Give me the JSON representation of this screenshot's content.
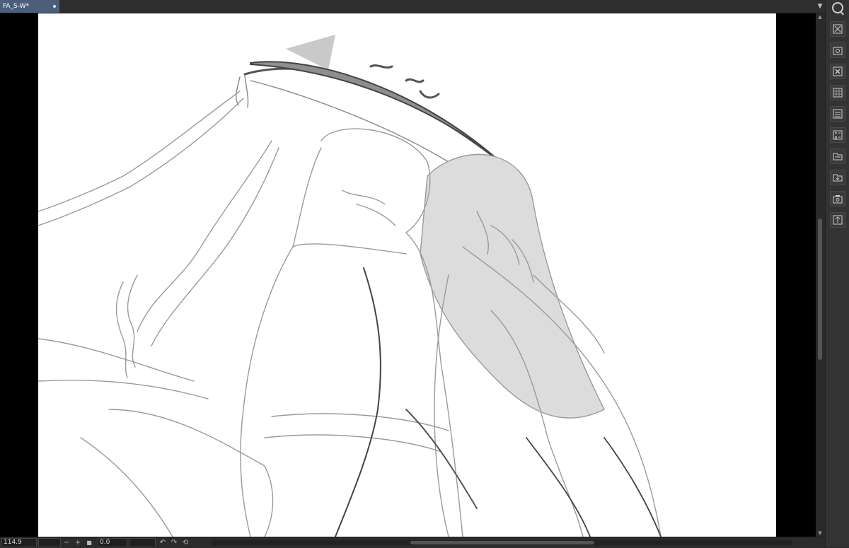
{
  "document_tab": {
    "title": "FA_S-W*"
  },
  "status_bar": {
    "zoom_value": "114.9",
    "rotation_value": "0.0",
    "zoom_out_symbol": "−",
    "zoom_in_symbol": "+",
    "fit_symbol": "■",
    "rotate_left_symbol": "↶",
    "rotate_right_symbol": "↷",
    "reset_symbol": "⟲"
  },
  "right_toolbar": {
    "buttons": [
      "close-canvas-icon",
      "screenshot-icon",
      "delete-icon",
      "grid-icon",
      "layer-list-icon",
      "calculator-icon",
      "folder-icon",
      "import-icon",
      "camera-icon",
      "share-icon"
    ]
  },
  "colors": {
    "tab_active": "#4c5f7a",
    "panel_dark": "#2b2b2b",
    "canvas_bg": "#ffffff",
    "sketch_stroke": "#7a7a7a",
    "hat_fill": "#8a8a8a"
  }
}
